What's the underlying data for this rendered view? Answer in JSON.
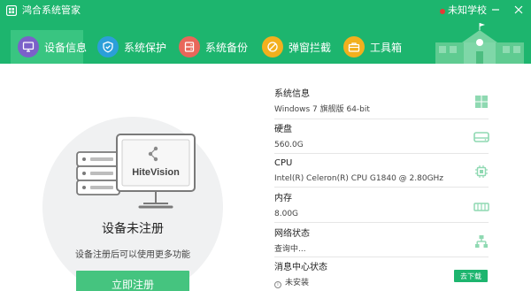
{
  "window": {
    "title": "鸿合系统管家",
    "school_name": "未知学校"
  },
  "tabs": [
    {
      "label": "设备信息",
      "icon": "monitor-icon",
      "color": "#7b61c9",
      "active": true
    },
    {
      "label": "系统保护",
      "icon": "shield-check-icon",
      "color": "#2b9fd9",
      "active": false
    },
    {
      "label": "系统备份",
      "icon": "backup-icon",
      "color": "#e8675a",
      "active": false
    },
    {
      "label": "弹窗拦截",
      "icon": "block-popup-icon",
      "color": "#f2b01e",
      "active": false
    },
    {
      "label": "工具箱",
      "icon": "toolbox-icon",
      "color": "#f2b01e",
      "active": false
    }
  ],
  "device": {
    "brand": "HiteVision",
    "status": "设备未注册",
    "hint": "设备注册后可以使用更多功能",
    "register_label": "立即注册"
  },
  "info": {
    "os_label": "系统信息",
    "os_value": "Windows 7 旗舰版 64-bit",
    "disk_label": "硬盘",
    "disk_value": "560.0G",
    "cpu_label": "CPU",
    "cpu_value": "Intel(R) Celeron(R) CPU G1840 @ 2.80GHz",
    "memory_label": "内存",
    "memory_value": "8.00G",
    "network_label": "网络状态",
    "network_value": "查询中...",
    "message_label": "消息中心状态",
    "message_value": "未安装",
    "download_label": "去下载"
  },
  "colors": {
    "header": "#1db56e",
    "active_tab": "#39c581",
    "accent": "#45c47f",
    "info_icon": "#8fd9b2"
  }
}
